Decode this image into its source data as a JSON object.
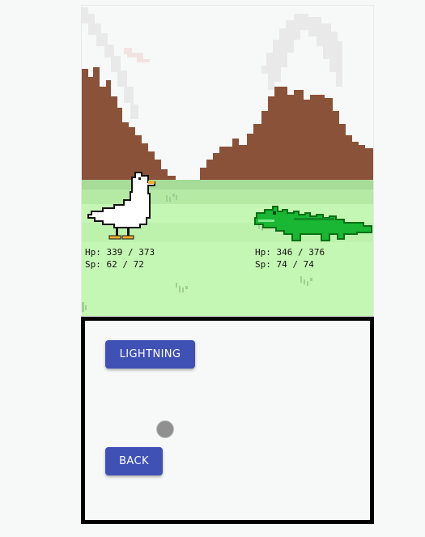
{
  "player": {
    "name": "goose",
    "hp_current": 339,
    "hp_max": 373,
    "sp_current": 62,
    "sp_max": 72,
    "hp_text": "Hp: 339 / 373",
    "sp_text": "Sp: 62 / 72"
  },
  "enemy": {
    "name": "crocodile",
    "hp_current": 346,
    "hp_max": 376,
    "sp_current": 74,
    "sp_max": 74,
    "hp_text": "Hp: 346 / 376",
    "sp_text": "Sp: 74 / 74"
  },
  "menu": {
    "lightning_label": "LIGHTNING",
    "back_label": "BACK"
  },
  "colors": {
    "button": "#3f51b5",
    "mountain": "#8b523a",
    "grass_light": "#c4f7b3",
    "grass_mid": "#b4eaa4",
    "grass_dark": "#a6dc98",
    "croc_green": "#19b733",
    "croc_dark": "#0b6f16"
  }
}
